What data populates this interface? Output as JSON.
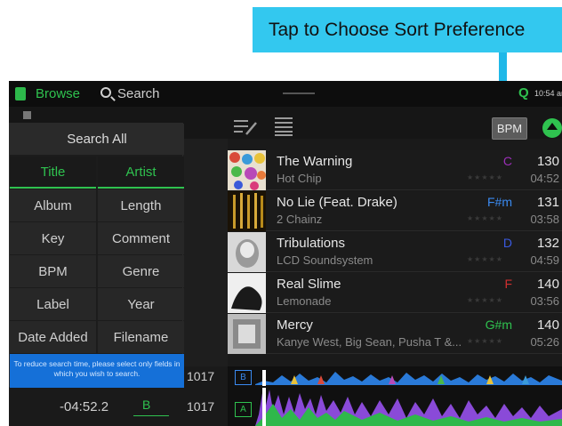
{
  "callout": {
    "text": "Tap to Choose Sort Preference"
  },
  "topbar": {
    "browse_label": "Browse",
    "search_label": "Search",
    "q_icon": "Q",
    "clock": "10:54 am"
  },
  "toolbar": {
    "sort_button_label": "BPM"
  },
  "search_popup": {
    "title": "Search All",
    "fields": [
      {
        "label": "Title",
        "selected": true
      },
      {
        "label": "Artist",
        "selected": true
      },
      {
        "label": "Album",
        "selected": false
      },
      {
        "label": "Length",
        "selected": false
      },
      {
        "label": "Key",
        "selected": false
      },
      {
        "label": "Comment",
        "selected": false
      },
      {
        "label": "BPM",
        "selected": false
      },
      {
        "label": "Genre",
        "selected": false
      },
      {
        "label": "Label",
        "selected": false
      },
      {
        "label": "Year",
        "selected": false
      },
      {
        "label": "Date Added",
        "selected": false
      },
      {
        "label": "Filename",
        "selected": false
      }
    ],
    "note": "To reduce search time, please select only fields in which you wish to search."
  },
  "tracks": [
    {
      "title": "The Warning",
      "artist": "Hot Chip",
      "key": "C",
      "key_color": "#9b2fb8",
      "bpm": "130",
      "length": "04:52",
      "stars": "★★★★★"
    },
    {
      "title": "No Lie (Feat. Drake)",
      "artist": "2 Chainz",
      "key": "F#m",
      "key_color": "#3a8af0",
      "bpm": "131",
      "length": "03:58",
      "stars": "★★★★★"
    },
    {
      "title": "Tribulations",
      "artist": "LCD Soundsystem",
      "key": "D",
      "key_color": "#3a5ae0",
      "bpm": "132",
      "length": "04:59",
      "stars": "★★★★★"
    },
    {
      "title": "Real Slime",
      "artist": "Lemonade",
      "key": "F",
      "key_color": "#d03030",
      "bpm": "140",
      "length": "03:56",
      "stars": "★★★★★"
    },
    {
      "title": "Mercy",
      "artist": "Kanye West, Big Sean, Pusha T &...",
      "key": "G#m",
      "key_color": "#2fc24f",
      "bpm": "140",
      "length": "05:26",
      "stars": "★★★★★"
    }
  ],
  "decks": [
    {
      "label": "B",
      "time": "",
      "bpm": "1017"
    },
    {
      "label": "A",
      "time": "-04:52.2",
      "bpm": "1017"
    }
  ],
  "lower_left": {
    "deck_b_bpm": "1017",
    "deck_a_time": "-04:52.2",
    "deck_a_label": "B",
    "deck_a_bpm": "1017"
  },
  "colors": {
    "accent": "#2fc24f",
    "callout_bg": "#33c8ef",
    "arrow": "#1fb8e8",
    "note_bg": "#1570d8"
  },
  "icons": [
    "browse-icon",
    "search-icon",
    "edit-list-icon",
    "list-icon",
    "sort-direction-icon",
    "chevron-right-icon"
  ]
}
